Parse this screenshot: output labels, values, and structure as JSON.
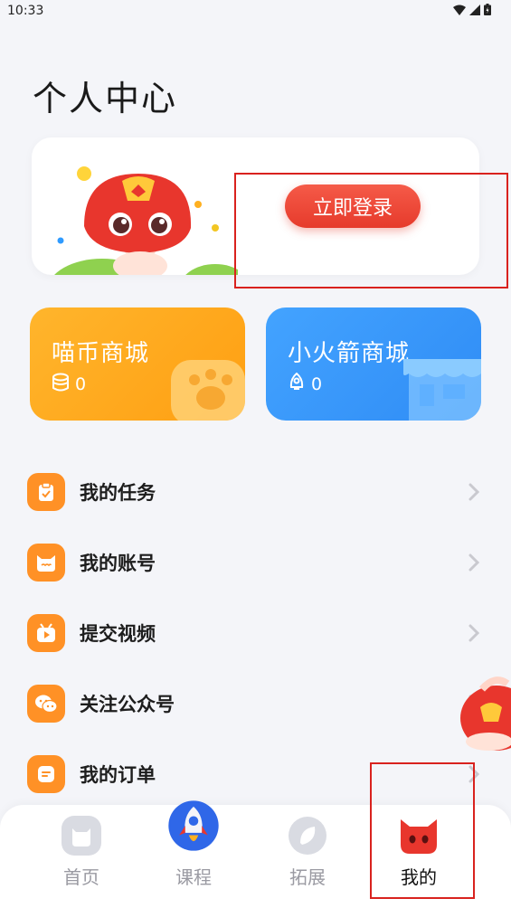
{
  "status_bar": {
    "time": "10:33"
  },
  "page_title": "个人中心",
  "login": {
    "button_label": "立即登录"
  },
  "malls": [
    {
      "title": "喵币商城",
      "count": "0",
      "icon": "coin-stack-icon",
      "color": "#ffa91e"
    },
    {
      "title": "小火箭商城",
      "count": "0",
      "icon": "rocket-outline-icon",
      "color": "#3b98fb"
    }
  ],
  "menu": [
    {
      "label": "我的任务",
      "icon": "clipboard-check-icon"
    },
    {
      "label": "我的账号",
      "icon": "cat-face-icon"
    },
    {
      "label": "提交视频",
      "icon": "video-play-icon"
    },
    {
      "label": "关注公众号",
      "icon": "wechat-icon"
    },
    {
      "label": "我的订单",
      "icon": "order-doc-icon"
    }
  ],
  "tabbar": {
    "tabs": [
      {
        "label": "首页",
        "icon": "home-cat-icon"
      },
      {
        "label": "课程",
        "icon": "rocket-icon"
      },
      {
        "label": "拓展",
        "icon": "leaf-icon"
      },
      {
        "label": "我的",
        "icon": "cat-profile-icon",
        "active": true
      }
    ]
  },
  "colors": {
    "accent": "#e63b2c",
    "menu_icon_bg": "#ff9126",
    "highlight": "#d9221e"
  }
}
